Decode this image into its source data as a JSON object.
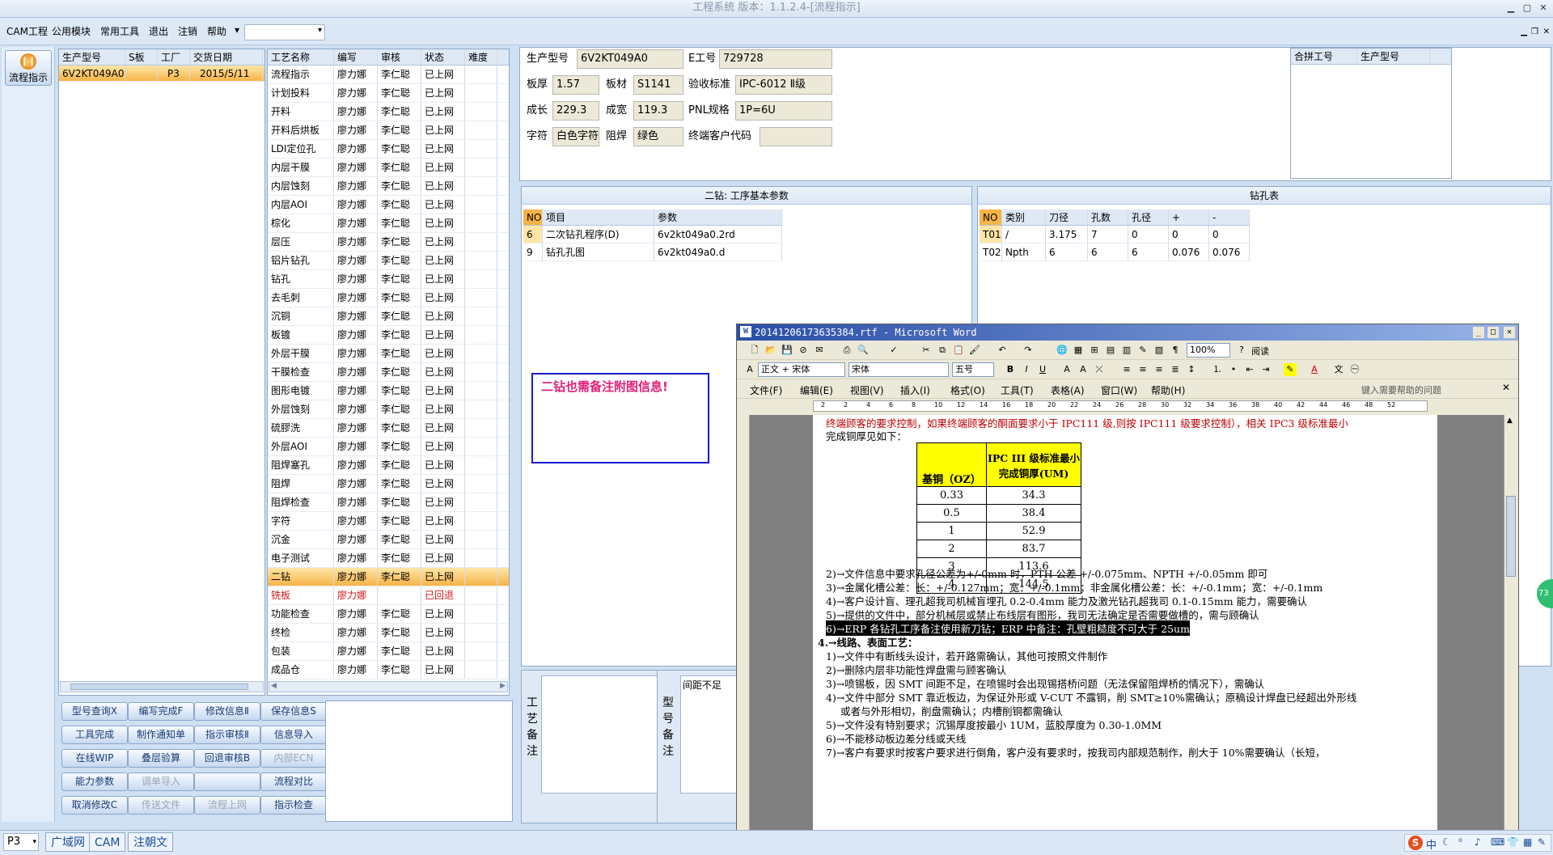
{
  "window": {
    "title": "工程系统 版本：1.1.2.4-[流程指示]"
  },
  "menu": {
    "items": [
      "CAM工程",
      "公用模块",
      "常用工具",
      "退出",
      "注销",
      "帮助"
    ],
    "dropdown_value": ""
  },
  "left_nav": {
    "flow_label": "流程指示"
  },
  "orders": {
    "headers": [
      "生产型号",
      "S板",
      "工厂",
      "交货日期"
    ],
    "rows": [
      [
        "6V2KT049A0",
        "",
        "P3",
        "2015/5/11"
      ]
    ]
  },
  "processes": {
    "headers": [
      "工艺名称",
      "编写",
      "审核",
      "状态",
      "难度"
    ],
    "rows": [
      [
        "流程指示",
        "廖力娜",
        "李仁聪",
        "已上网",
        ""
      ],
      [
        "计划投料",
        "廖力娜",
        "李仁聪",
        "已上网",
        ""
      ],
      [
        "开料",
        "廖力娜",
        "李仁聪",
        "已上网",
        ""
      ],
      [
        "开料后烘板",
        "廖力娜",
        "李仁聪",
        "已上网",
        ""
      ],
      [
        "LDI定位孔",
        "廖力娜",
        "李仁聪",
        "已上网",
        ""
      ],
      [
        "内层干膜",
        "廖力娜",
        "李仁聪",
        "已上网",
        ""
      ],
      [
        "内层蚀刻",
        "廖力娜",
        "李仁聪",
        "已上网",
        ""
      ],
      [
        "内层AOI",
        "廖力娜",
        "李仁聪",
        "已上网",
        ""
      ],
      [
        "棕化",
        "廖力娜",
        "李仁聪",
        "已上网",
        ""
      ],
      [
        "层压",
        "廖力娜",
        "李仁聪",
        "已上网",
        ""
      ],
      [
        "铝片钻孔",
        "廖力娜",
        "李仁聪",
        "已上网",
        ""
      ],
      [
        "钻孔",
        "廖力娜",
        "李仁聪",
        "已上网",
        ""
      ],
      [
        "去毛刺",
        "廖力娜",
        "李仁聪",
        "已上网",
        ""
      ],
      [
        "沉铜",
        "廖力娜",
        "李仁聪",
        "已上网",
        ""
      ],
      [
        "板镀",
        "廖力娜",
        "李仁聪",
        "已上网",
        ""
      ],
      [
        "外层干膜",
        "廖力娜",
        "李仁聪",
        "已上网",
        ""
      ],
      [
        "干膜检查",
        "廖力娜",
        "李仁聪",
        "已上网",
        ""
      ],
      [
        "图形电镀",
        "廖力娜",
        "李仁聪",
        "已上网",
        ""
      ],
      [
        "外层蚀刻",
        "廖力娜",
        "李仁聪",
        "已上网",
        ""
      ],
      [
        "硫膠洗",
        "廖力娜",
        "李仁聪",
        "已上网",
        ""
      ],
      [
        "外层AOI",
        "廖力娜",
        "李仁聪",
        "已上网",
        ""
      ],
      [
        "阻焊塞孔",
        "廖力娜",
        "李仁聪",
        "已上网",
        ""
      ],
      [
        "阻焊",
        "廖力娜",
        "李仁聪",
        "已上网",
        ""
      ],
      [
        "阻焊检查",
        "廖力娜",
        "李仁聪",
        "已上网",
        ""
      ],
      [
        "字符",
        "廖力娜",
        "李仁聪",
        "已上网",
        ""
      ],
      [
        "沉金",
        "廖力娜",
        "李仁聪",
        "已上网",
        ""
      ],
      [
        "电子测试",
        "廖力娜",
        "李仁聪",
        "已上网",
        ""
      ],
      [
        "二钻",
        "廖力娜",
        "李仁聪",
        "已上网",
        ""
      ],
      [
        "铣板",
        "廖力娜",
        "",
        "已回退",
        ""
      ],
      [
        "功能检查",
        "廖力娜",
        "李仁聪",
        "已上网",
        ""
      ],
      [
        "终检",
        "廖力娜",
        "李仁聪",
        "已上网",
        ""
      ],
      [
        "包装",
        "廖力娜",
        "李仁聪",
        "已上网",
        ""
      ],
      [
        "成品仓",
        "廖力娜",
        "李仁聪",
        "已上网",
        ""
      ]
    ]
  },
  "buttons": [
    [
      "型号查询Ⅹ",
      "编写完成F",
      "修改信息Ⅱ",
      "保存信息S"
    ],
    [
      "工具完成",
      "制作通知单",
      "指示审核Ⅱ",
      "信息导入"
    ],
    [
      "在线WIP",
      "叠层验算",
      "回退审核B",
      "内部ECN"
    ],
    [
      "能力参数",
      "调单导入",
      "",
      "流程对比"
    ],
    [
      "取消修改C",
      "传送文件",
      "流程上网",
      "指示检查"
    ]
  ],
  "info": {
    "prod_model_label": "生产型号",
    "prod_model": "6V2KT049A0",
    "e_no_label": "E工号",
    "e_no": "729728",
    "thickness_label": "板厚",
    "thickness": "1.57",
    "material_label": "板材",
    "material": "S1141",
    "std_label": "验收标准",
    "std": "IPC-6012 Ⅱ级",
    "length_label": "成长",
    "length": "229.3",
    "width_label": "成宽",
    "width": "119.3",
    "pnl_label": "PNL规格",
    "pnl": "1P=6U",
    "char_label": "字符",
    "char": "白色字符",
    "mask_label": "阻焊",
    "mask": "绿色",
    "cust_label": "终端客户代码",
    "cust": ""
  },
  "merge": {
    "headers": [
      "合拼工号",
      "生产型号"
    ]
  },
  "drill2": {
    "title": "二钻: 工序基本参数",
    "headers": [
      "NO",
      "项目",
      "参数"
    ],
    "rows": [
      [
        "6",
        "二次钻孔程序(D)",
        "6v2kt049a0.2rd"
      ],
      [
        "9",
        "钻孔孔图",
        "6v2kt049a0.d"
      ]
    ],
    "note": "二钻也需备注附图信息!"
  },
  "drilltable": {
    "title": "钻孔表",
    "headers": [
      "NO",
      "类别",
      "刀径",
      "孔数",
      "孔径",
      "+",
      "-"
    ],
    "rows": [
      [
        "T01",
        "/",
        "3.175",
        "7",
        "0",
        "0",
        "0"
      ],
      [
        "T02",
        "Npth",
        "6",
        "6",
        "6",
        "0.076",
        "0.076"
      ]
    ]
  },
  "remarks": {
    "process_label": "工艺备注",
    "model_label": "型号备注",
    "model_text": "间距不足"
  },
  "word": {
    "title": "20141206173635384.rtf - Microsoft Word",
    "style": "正文 + 宋体",
    "font": "宋体",
    "size": "五号",
    "zoom": "100%",
    "read": "阅读",
    "menus": [
      "文件(F)",
      "编辑(E)",
      "视图(V)",
      "插入(I)",
      "格式(O)",
      "工具(T)",
      "表格(A)",
      "窗口(W)",
      "帮助(H)"
    ],
    "help_placeholder": "键入需要帮助的问题",
    "ruler": [
      "2",
      "2",
      "4",
      "6",
      "8",
      "10",
      "12",
      "14",
      "16",
      "18",
      "20",
      "22",
      "24",
      "26",
      "28",
      "30",
      "32",
      "34",
      "36",
      "38",
      "40",
      "42",
      "44",
      "46",
      "48",
      "52"
    ],
    "line_top": "终端顾客的要求控制，如果终端顾客的酮面要求小于 IPC111 级,则按 IPC111 级要求控制），相关 IPC3 级标准最小",
    "line_top2": "完成铜厚见如下：",
    "cu_head": [
      "基铜（OZ）",
      "IPC III 级标准最小完成铜厚(UM)"
    ],
    "cu_rows": [
      [
        "0.33",
        "34.3"
      ],
      [
        "0.5",
        "38.4"
      ],
      [
        "1",
        "52.9"
      ],
      [
        "2",
        "83.7"
      ],
      [
        "3",
        "113.6"
      ],
      [
        "4",
        "144.5"
      ]
    ],
    "lines": [
      "2)→文件信息中要求孔径公差为+/-0mm 时，PTH 公差 +/-0.075mm、NPTH +/-0.05mm 即可",
      "3)→金属化槽公差：长：+/-0.127mm；宽：+/-0.1mm；非金属化槽公差：长：+/-0.1mm；宽：+/-0.1mm",
      "4)→客户设计盲、理孔超我司机械盲埋孔 0.2-0.4mm 能力及激光钻孔超我司 0.1-0.15mm 能力，需要确认",
      "5)→提供的文件中，部分机械层或禁止布线层有图形，我司无法确定是否需要做槽的，需与顾确认",
      "6)→ERP 各钻孔工序备注使用新刀钻；ERP 中备注：孔壁粗糙度不可大于 25um",
      "4.→线路、表面工艺：",
      "1)→文件中有断线头设计，若开路需确认，其他可按照文件制作",
      "2)→删除内层非功能性焊盘需与顾客确认",
      "3)→喷锡板，因 SMT 间距不足，在喷锡时会出现锡搭桥问题（无法保留阻焊桥的情况下），需确认",
      "4)→文件中部分 SMT 靠近板边，为保证外形或 V-CUT 不露铜，削 SMT≥10%需确认；原稿设计焊盘已经超出外形线",
      "或者与外形相切，削盘需确认；内槽削铜都需确认",
      "5)→文件没有特别要求；沉锡厚度按最小 1UM，蓝胶厚度为 0.30-1.0MM",
      "6)→不能移动板边差分线或天线",
      "7)→客户有要求时按客户要求进行倒角，客户没有要求时，按我司内部规范制作，削大于 10%需要确认（长短，"
    ]
  },
  "status": {
    "combo": "P3",
    "tabs": [
      "广域网",
      "CAM",
      "注朝文"
    ]
  },
  "tray": {
    "ime": "中"
  }
}
